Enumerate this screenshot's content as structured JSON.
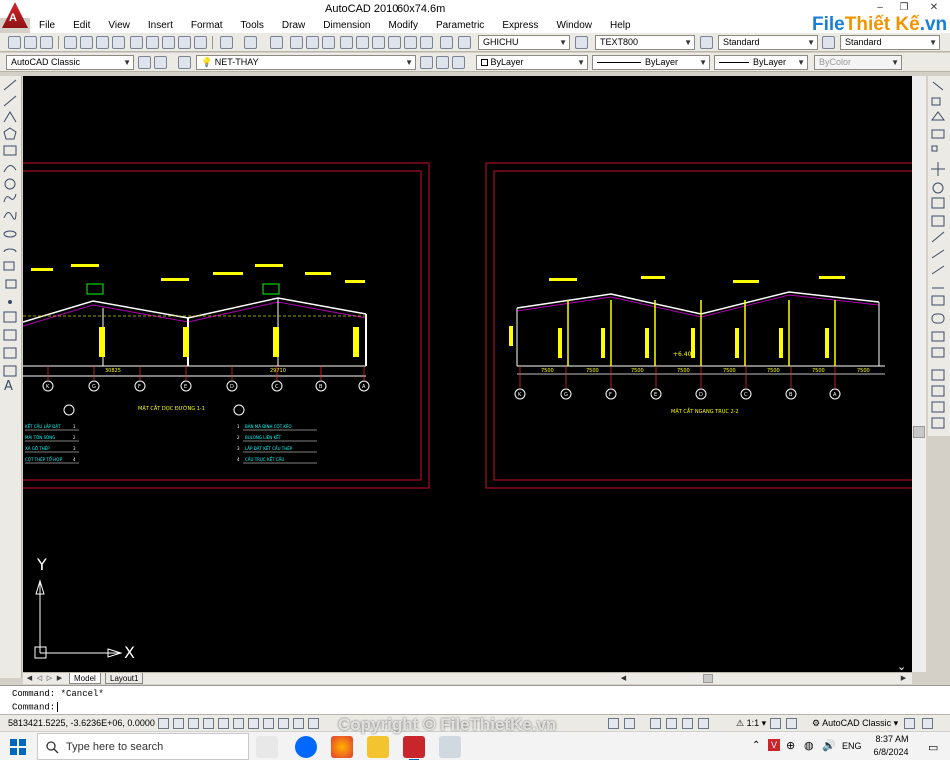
{
  "window": {
    "app_title": "AutoCAD 2010",
    "file_title": "60x74.6m",
    "min_glyph": "–",
    "restore_glyph": "❐",
    "close_glyph": "✕",
    "logo_letter": "A"
  },
  "menu": [
    "File",
    "Edit",
    "View",
    "Insert",
    "Format",
    "Tools",
    "Draw",
    "Dimension",
    "Modify",
    "Parametric",
    "Express",
    "Window",
    "Help"
  ],
  "watermark": {
    "brand_a": "File",
    "brand_b": "Thiết Kế",
    "brand_c": ".vn",
    "copyright": "Copyright © FileThietKe.vn"
  },
  "toolbar1": {
    "text_style": "GHICHU",
    "dim_style": "TEXT800",
    "table_style": "Standard",
    "multileader_style": "Standard"
  },
  "toolbar2": {
    "workspace": "AutoCAD Classic",
    "layer": "NET-THAY",
    "color": "ByLayer",
    "linetype": "ByLayer",
    "lineweight": "ByLayer",
    "plotstyle": "ByColor"
  },
  "drawing": {
    "ucs_y": "Y",
    "ucs_x": "X",
    "left_frame": {
      "dims": [
        "30825",
        "29710"
      ],
      "section_title": "MẶT CẮT DỌC ĐƯỜNG 1-1",
      "axis_labels": [
        "K",
        "G",
        "F",
        "E",
        "D",
        "C",
        "B",
        "A"
      ],
      "notes_left": [
        "KẾT CẤU LẮP ĐẶT",
        "MÁI TÔN SÓNG",
        "XÀ GỒ THÉP",
        "CỘT THÉP TỔ HỢP"
      ],
      "notes_numbers": [
        "1",
        "2",
        "3",
        "4"
      ],
      "notes_right": [
        "BẢN MÃ ĐỈNH CỘT KÈO",
        "BULONG LIÊN KẾT",
        "LẮP ĐẶT KẾT CẤU THÉP",
        "CẦU TRỤC KẾT CẤU"
      ]
    },
    "right_frame": {
      "dims": [
        "7500",
        "7500",
        "7500",
        "7500",
        "7500",
        "7500",
        "7500",
        "7500"
      ],
      "section_title": "MẶT CẮT NGANG TRỤC 2-2",
      "axis_labels": [
        "K",
        "G",
        "F",
        "E",
        "D",
        "C",
        "B",
        "A"
      ],
      "elevation": "+6.40"
    }
  },
  "tabs": [
    "Model",
    "Layout1"
  ],
  "command": {
    "history": "Command: *Cancel*",
    "prompt": "Command:"
  },
  "status": {
    "coords": "5813421.5225, -3.6236E+06, 0.0000",
    "annotation_scale": "1:1",
    "workspace": "AutoCAD Classic"
  },
  "taskbar": {
    "search_placeholder": "Type here to search",
    "language": "ENG",
    "time": "8:37 AM",
    "date": "6/8/2024"
  },
  "colors": {
    "canvas": "#000000",
    "frame": "#c8102e",
    "structure": "#ffffff",
    "annotation": "#ffff00",
    "axis": "#ff3030",
    "note": "#00ffff"
  }
}
